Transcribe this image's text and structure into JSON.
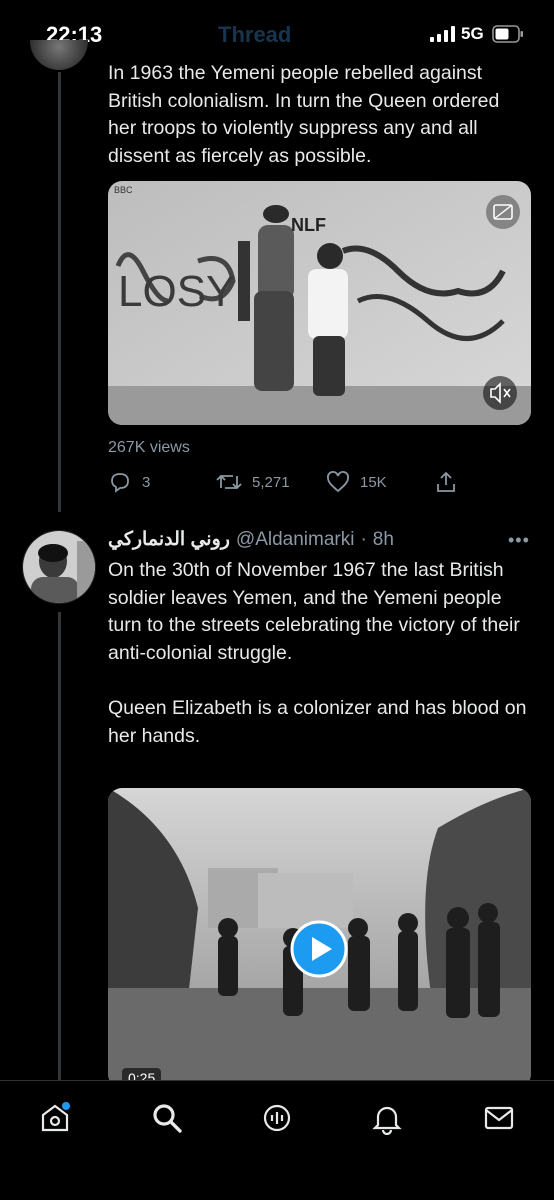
{
  "status_bar": {
    "time": "22:13",
    "header_title_faded": "Thread",
    "network": "5G"
  },
  "tweet1": {
    "text": "In 1963 the Yemeni people rebelled against British colonialism. In turn the Queen ordered her troops to violently suppress any and all dissent as fiercely as possible.",
    "video_overlay_labels": [
      "BBC",
      "NLF",
      "LOSY"
    ],
    "views": "267K views",
    "replies": "3",
    "retweets": "5,271",
    "likes": "15K"
  },
  "tweet2": {
    "author_name": "روني الدنماركي",
    "handle": "@Aldanimarki",
    "separator": "·",
    "time_ago": "8h",
    "text": "On the 30th of November 1967 the last British soldier leaves Yemen, and the Yemeni people turn to the streets celebrating the victory of their anti-colonial struggle.\n\nQueen Elizabeth is a colonizer and has blood on her hands.",
    "video_duration": "0:25"
  },
  "icons": {
    "status": [
      "signal-icon",
      "battery-icon"
    ],
    "video": [
      "captions-icon",
      "mute-icon",
      "play-icon"
    ],
    "actions": [
      "reply-icon",
      "retweet-icon",
      "like-icon",
      "share-icon",
      "more-icon"
    ],
    "nav": [
      "home-icon",
      "search-icon",
      "spaces-icon",
      "notifications-icon",
      "messages-icon"
    ]
  },
  "colors": {
    "background": "#000000",
    "text": "#e7e9ea",
    "secondary_text": "#8b98a5",
    "accent_blue": "#1d9bf0",
    "thread_line": "#333639"
  }
}
